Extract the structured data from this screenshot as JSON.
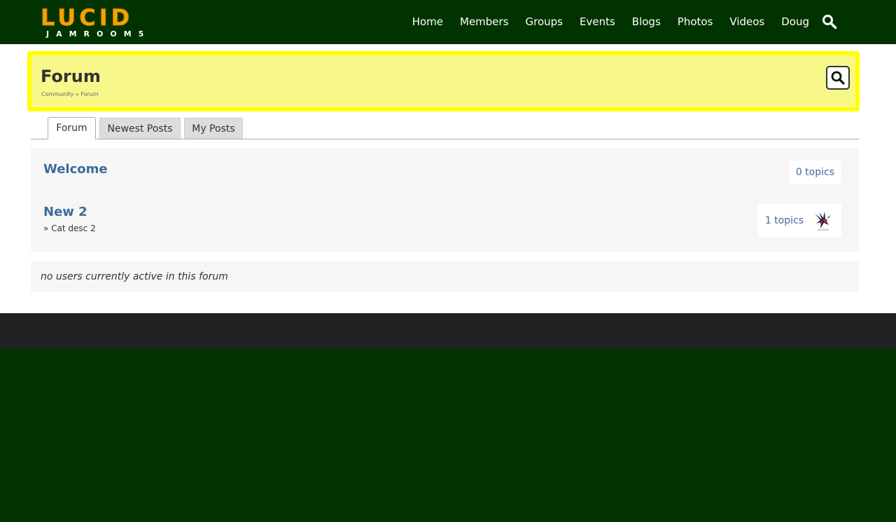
{
  "brand": {
    "name": "LUCID",
    "tagline": "JAMROOM5"
  },
  "nav": {
    "items": [
      {
        "label": "Home"
      },
      {
        "label": "Members"
      },
      {
        "label": "Groups"
      },
      {
        "label": "Events"
      },
      {
        "label": "Blogs"
      },
      {
        "label": "Photos"
      },
      {
        "label": "Videos"
      },
      {
        "label": "Doug"
      }
    ],
    "search_icon": "search-icon"
  },
  "header": {
    "title": "Forum",
    "breadcrumb": "Community » Forum",
    "search_icon": "search-icon"
  },
  "tabs": [
    {
      "label": "Forum",
      "active": true
    },
    {
      "label": "Newest Posts",
      "active": false
    },
    {
      "label": "My Posts",
      "active": false
    }
  ],
  "categories": [
    {
      "title": "Welcome",
      "description": "",
      "topics": "0 topics"
    },
    {
      "title": "New 2",
      "description": "» Cat desc 2",
      "topics": "1 topics",
      "avatar_icon": "eagle-avatar-icon"
    }
  ],
  "active_users_text": "no users currently active in this forum",
  "colors": {
    "nav_background": "#003300",
    "logo_orange": "#f5a300",
    "header_highlight": "#ffff00",
    "header_background": "#f8f78a",
    "link_blue": "#3d6b9c",
    "footer": "#222222"
  }
}
